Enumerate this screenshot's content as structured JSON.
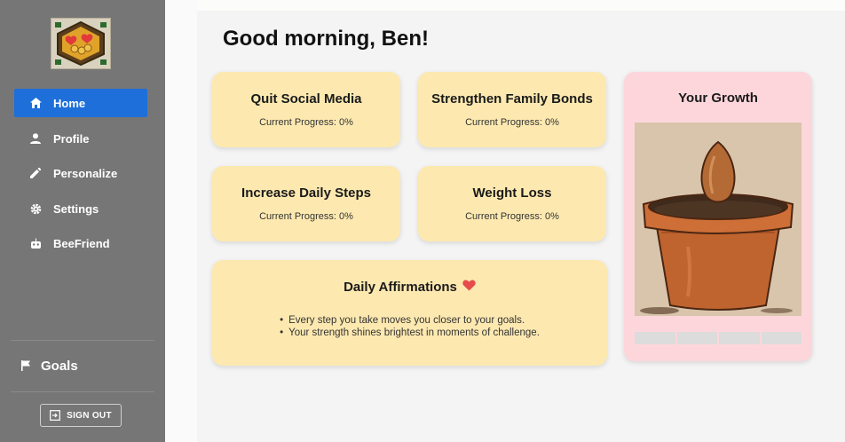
{
  "sidebar": {
    "nav": [
      {
        "label": "Home",
        "icon": "home-icon",
        "active": true
      },
      {
        "label": "Profile",
        "icon": "person-icon"
      },
      {
        "label": "Personalize",
        "icon": "pencil-icon"
      },
      {
        "label": "Settings",
        "icon": "gear-icon"
      },
      {
        "label": "BeeFriend",
        "icon": "bot-icon"
      }
    ],
    "goals_label": "Goals",
    "sign_out_label": "SIGN OUT"
  },
  "main": {
    "greeting": "Good morning, Ben!",
    "goal_cards": [
      {
        "title": "Quit Social Media",
        "progress": "Current Progress: 0%"
      },
      {
        "title": "Strengthen Family Bonds",
        "progress": "Current Progress: 0%"
      },
      {
        "title": "Increase Daily Steps",
        "progress": "Current Progress: 0%"
      },
      {
        "title": "Weight Loss",
        "progress": "Current Progress: 0%"
      }
    ],
    "affirmations": {
      "title": "Daily Affirmations",
      "items": [
        "Every step you take moves you closer to your goals.",
        "Your strength shines brightest in moments of challenge."
      ]
    },
    "growth": {
      "title": "Your Growth",
      "progress_fraction": 0,
      "segments": 4
    }
  },
  "colors": {
    "sidebar_bg": "#767676",
    "active_nav": "#1e6fd9",
    "goal_card_bg": "#fde9b0",
    "growth_card_bg": "#fdd6dc",
    "heart": "#e74c4c"
  }
}
